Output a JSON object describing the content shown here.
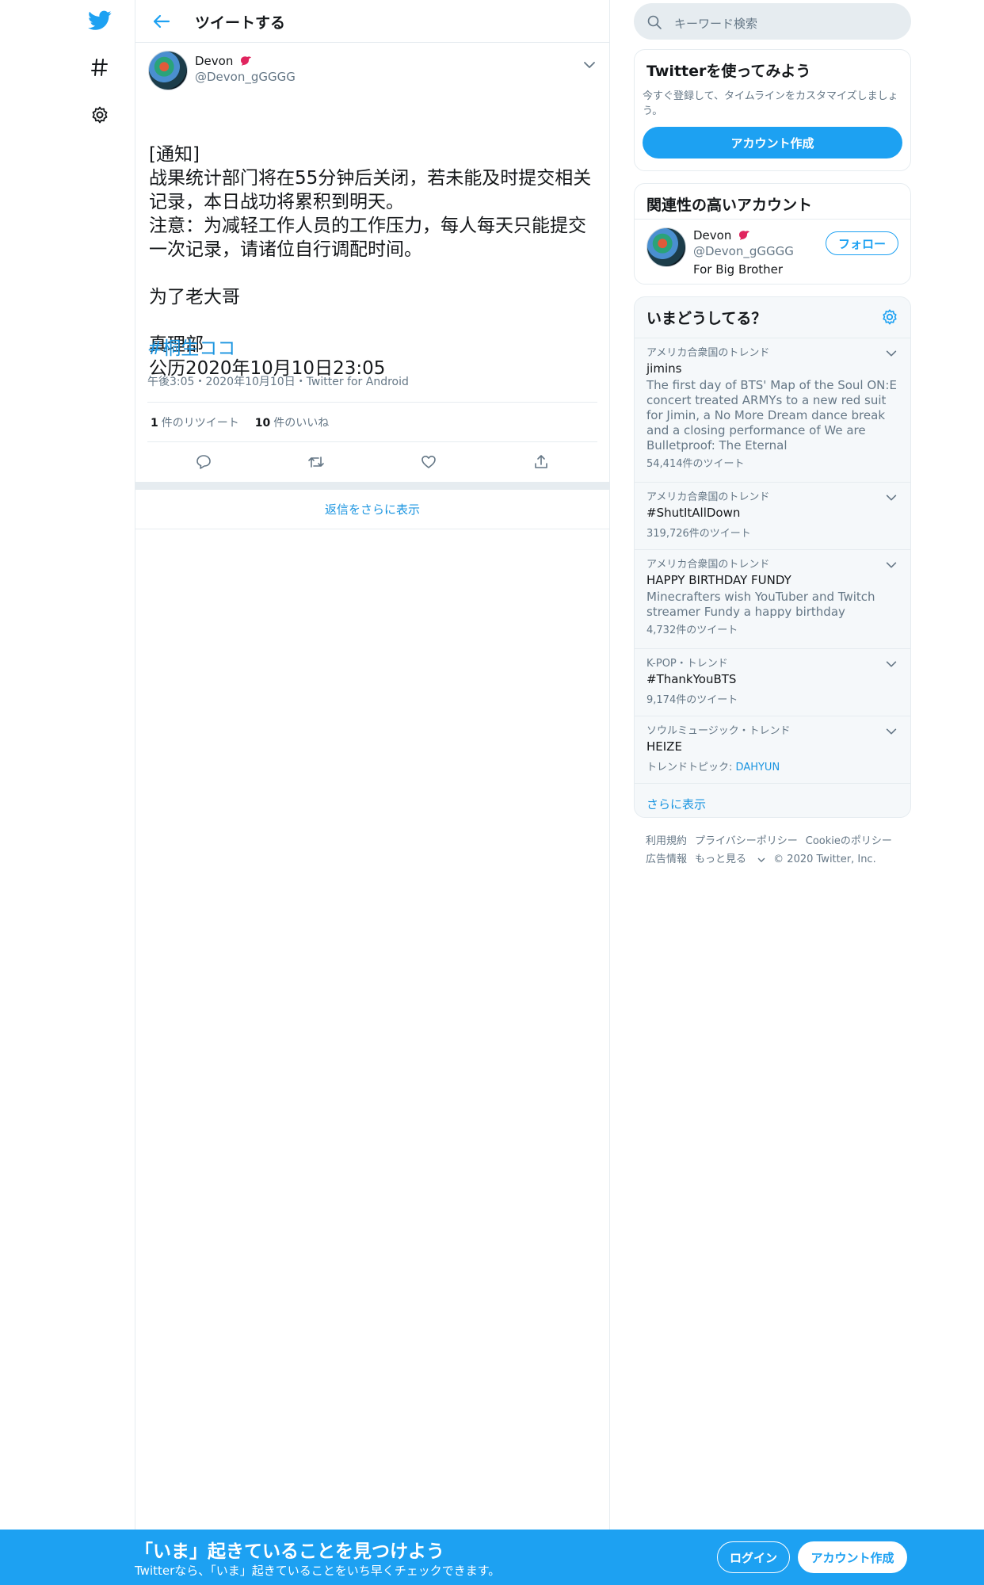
{
  "header": {
    "title": "ツイートする"
  },
  "tweet": {
    "author_name": "Devon",
    "author_handle": "@Devon_gGGGG",
    "text": "[通知]\n战果统计部门将在55分钟后关闭，若未能及时提交相关记录，本日战功将累积到明天。\n注意：为减轻工作人员的工作压力，每人每天只能提交一次记录，请诸位自行调配时间。\n\n为了老大哥\n\n真理部\n公历2020年10月10日23:05",
    "hashtag": "#桐生ココ",
    "meta": "午後3:05・2020年10月10日・Twitter for Android",
    "retweets_count": "1",
    "retweets_label": "件のリツイート",
    "likes_count": "10",
    "likes_label": "件のいいね"
  },
  "replies": {
    "show_more": "返信をさらに表示"
  },
  "search": {
    "placeholder": "キーワード検索"
  },
  "signup_card": {
    "title": "Twitterを使ってみよう",
    "desc": "今すぐ登録して、タイムラインをカスタマイズしましょう。",
    "button": "アカウント作成"
  },
  "related_card": {
    "title": "関連性の高いアカウント",
    "name": "Devon",
    "handle": "@Devon_gGGGG",
    "bio": "For Big Brother",
    "follow": "フォロー"
  },
  "trends_card": {
    "title": "いまどうしてる？",
    "items": [
      {
        "context": "アメリカ合衆国のトレンド",
        "name": "jimins",
        "desc": "The first day of BTS' Map of the Soul ON:E concert treated ARMYs to a new red suit for Jimin, a No More Dream dance break and a closing performance of We are Bulletproof: The Eternal",
        "count": "54,414件のツイート"
      },
      {
        "context": "アメリカ合衆国のトレンド",
        "name": "#ShutItAllDown",
        "count": "319,726件のツイート"
      },
      {
        "context": "アメリカ合衆国のトレンド",
        "name": "HAPPY BIRTHDAY FUNDY",
        "desc": "Minecrafters wish YouTuber and Twitch streamer Fundy a happy birthday",
        "count": "4,732件のツイート"
      },
      {
        "context": "K-POP・トレンド",
        "name": "#ThankYouBTS",
        "count": "9,174件のツイート"
      },
      {
        "context": "ソウルミュージック・トレンド",
        "name": "HEIZE",
        "topic_label": "トレンドトピック:",
        "topic_link": "DAHYUN"
      }
    ],
    "show_more": "さらに表示"
  },
  "footer": {
    "terms": "利用規約",
    "privacy": "プライバシーポリシー",
    "cookie": "Cookieのポリシー",
    "ads": "広告情報",
    "more": "もっと見る",
    "copyright": "© 2020 Twitter, Inc."
  },
  "bottom_bar": {
    "title": "「いま」起きていることを見つけよう",
    "subtitle": "Twitterなら、「いま」起きていることをいち早くチェックできます。",
    "login": "ログイン",
    "signup": "アカウント作成"
  },
  "colors": {
    "accent": "#1da1f2",
    "link": "#1b95e0",
    "border": "#e6ecf0",
    "muted": "#657786"
  },
  "icons": [
    "twitter-logo-icon",
    "hashtag-icon",
    "gear-icon",
    "back-arrow-icon",
    "chevron-down-icon",
    "reply-icon",
    "retweet-icon",
    "like-icon",
    "share-icon",
    "search-icon"
  ]
}
